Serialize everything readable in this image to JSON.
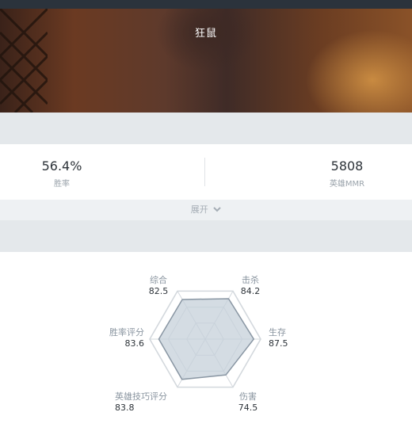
{
  "header": {
    "title": "狂鼠"
  },
  "stats": {
    "win_rate": {
      "value": "56.4%",
      "label": "胜率"
    },
    "mmr": {
      "value": "5808",
      "label": "英雄MMR"
    }
  },
  "expand_label": "展开",
  "radar": {
    "max": 100,
    "axes": [
      {
        "key": "top_left",
        "name": "综合",
        "value": "82.5",
        "score": 82.5
      },
      {
        "key": "top_right",
        "name": "击杀",
        "value": "84.2",
        "score": 84.2
      },
      {
        "key": "right",
        "name": "生存",
        "value": "87.5",
        "score": 87.5
      },
      {
        "key": "bottom_right",
        "name": "伤害",
        "value": "74.5",
        "score": 74.5
      },
      {
        "key": "bottom_left",
        "name": "英雄技巧评分",
        "value": "83.8",
        "score": 83.8
      },
      {
        "key": "left",
        "name": "胜率评分",
        "value": "83.6",
        "score": 83.6
      }
    ]
  },
  "colors": {
    "fill": "#c6d0d9",
    "stroke": "#8996a3",
    "grid": "#d3d8dd"
  }
}
